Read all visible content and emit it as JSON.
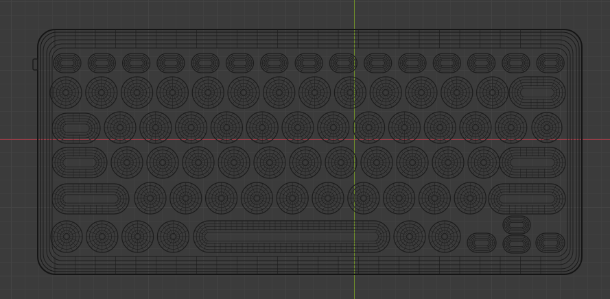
{
  "viewport": {
    "view": "wireframe-top",
    "object": "keyboard-mesh"
  },
  "colors": {
    "background": "#3b3b3b",
    "grid_minor": "#404040",
    "grid_major": "#444444",
    "axis_x": "#9a3b46",
    "axis_y": "#6f8f2a",
    "wire": "#1c1c1c",
    "wire_light": "#2a2a2a"
  },
  "keyboard": {
    "rows": [
      {
        "name": "function-row",
        "keys": 15,
        "shape": "small-oval"
      },
      {
        "name": "number-row",
        "keys": 14,
        "shape": "round",
        "end": "backspace"
      },
      {
        "name": "qwerty-row",
        "keys": 14,
        "shape": "round",
        "start": "tab",
        "end": "small-round"
      },
      {
        "name": "home-row",
        "keys": 12,
        "shape": "round",
        "start": "caps",
        "end": "enter"
      },
      {
        "name": "shift-row",
        "keys": 11,
        "shape": "round",
        "start": "left-shift",
        "end": "right-shift"
      },
      {
        "name": "bottom-row",
        "keys": 9,
        "shape": "round",
        "middle": "spacebar",
        "end": "arrow-cluster"
      }
    ]
  }
}
